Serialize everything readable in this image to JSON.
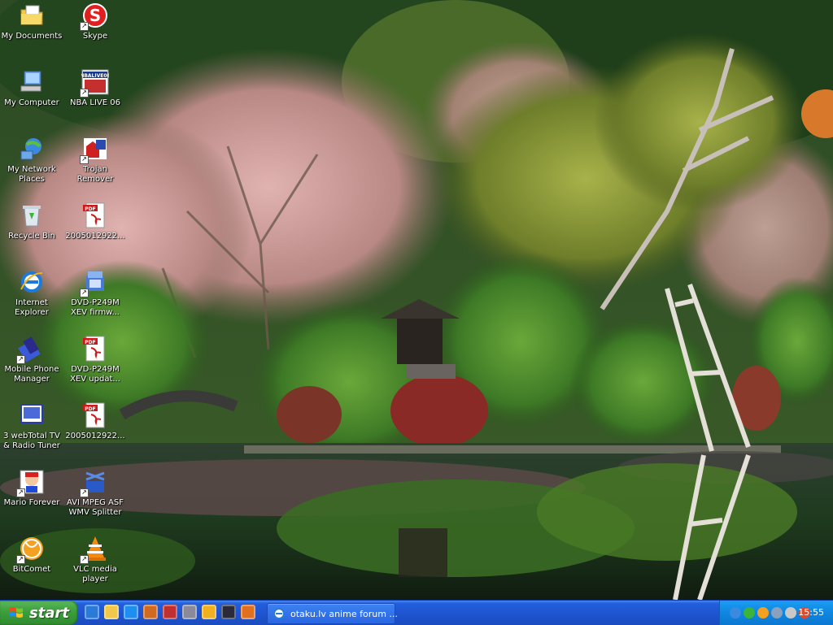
{
  "desktop": {
    "icons": [
      {
        "label": "My Documents",
        "icon": "folder-documents-icon"
      },
      {
        "label": "Skype",
        "icon": "skype-icon"
      },
      {
        "label": "My Computer",
        "icon": "computer-icon"
      },
      {
        "label": "NBA LIVE 06",
        "icon": "nba-live-icon",
        "image_text": "NBALIVE06"
      },
      {
        "label": "My Network\nPlaces",
        "icon": "network-places-icon"
      },
      {
        "label": "Trojan\nRemover",
        "icon": "trojan-remover-icon"
      },
      {
        "label": "Recycle Bin",
        "icon": "recycle-bin-icon"
      },
      {
        "label": "2005012922...",
        "icon": "pdf-icon",
        "image_text": "PDF"
      },
      {
        "label": "Internet\nExplorer",
        "icon": "internet-explorer-icon"
      },
      {
        "label": "DVD-P249M\nXEV firmw...",
        "icon": "firmware-icon"
      },
      {
        "label": "Mobile Phone\nManager",
        "icon": "mobile-phone-icon"
      },
      {
        "label": "DVD-P249M\nXEV updat...",
        "icon": "pdf-icon",
        "image_text": "PDF"
      },
      {
        "label": "3 webTotal TV\n& Radio Tuner",
        "icon": "tv-tuner-icon"
      },
      {
        "label": "2005012922...",
        "icon": "pdf-icon",
        "image_text": "PDF"
      },
      {
        "label": "Mario Forever",
        "icon": "mario-icon"
      },
      {
        "label": "AVI MPEG ASF\nWMV Splitter",
        "icon": "splitter-icon"
      },
      {
        "label": "BitComet",
        "icon": "bitcomet-icon"
      },
      {
        "label": "VLC media\nplayer",
        "icon": "vlc-icon"
      }
    ]
  },
  "taskbar": {
    "start_label": "start",
    "quick_launch": [
      "ie-quicklaunch-icon",
      "explorer-quicklaunch-icon",
      "ie2-quicklaunch-icon",
      "game-quicklaunch-icon",
      "media-quicklaunch-icon",
      "disc-quicklaunch-icon",
      "tool-quicklaunch-icon",
      "terminal-quicklaunch-icon",
      "browser-quicklaunch-icon"
    ],
    "tasks": [
      {
        "label": "otaku.lv anime forum ...",
        "icon": "ie-icon"
      }
    ],
    "tray_icons": [
      "tray-arrow-icon",
      "tray-check-icon",
      "tray-orange-icon",
      "tray-network-icon",
      "tray-volume-icon",
      "tray-messenger-icon"
    ],
    "clock": "15:55"
  }
}
